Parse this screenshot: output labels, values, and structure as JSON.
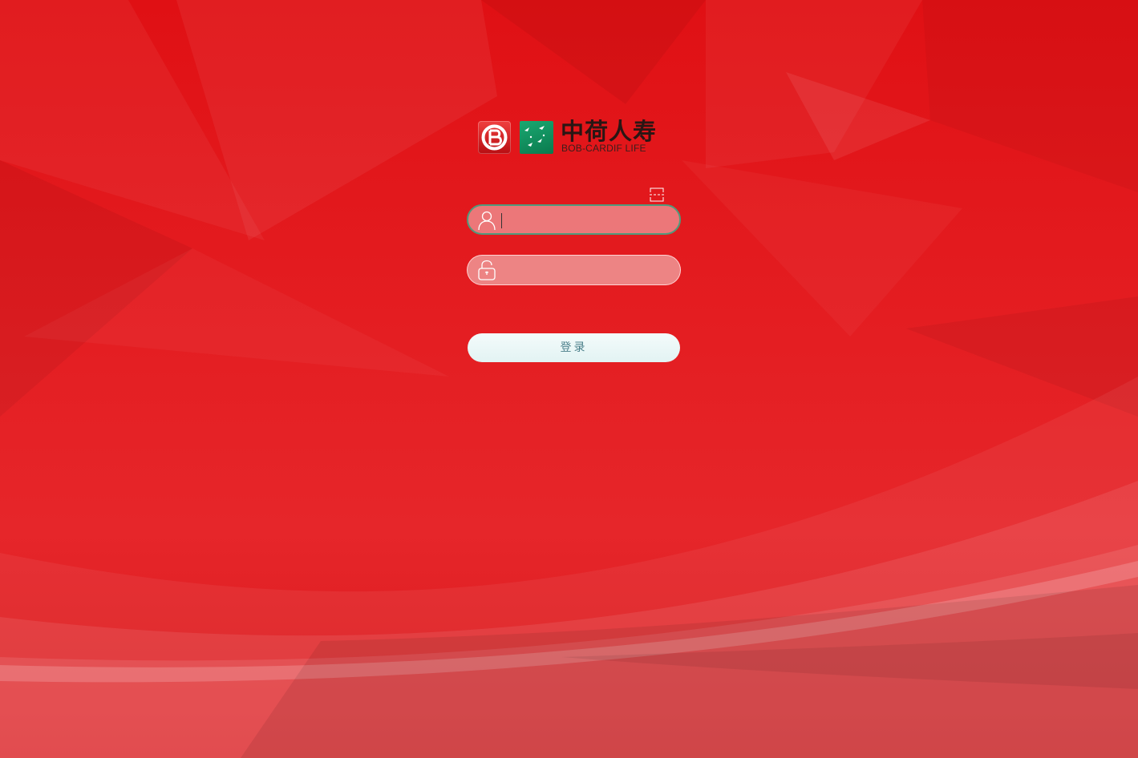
{
  "logo": {
    "name_cn": "中荷人寿",
    "name_en": "BOB-CARDIF LIFE"
  },
  "icons": {
    "qr": "qr-scan-icon",
    "user": "user-icon",
    "lock": "unlock-icon",
    "bank_logo": "bob-logo-icon",
    "cardif_logo": "cardif-birds-icon"
  },
  "form": {
    "username": {
      "value": "",
      "placeholder": ""
    },
    "password": {
      "value": "",
      "placeholder": ""
    },
    "login_label": "登录"
  },
  "colors": {
    "background": "#e31b1f",
    "focus_border": "#4f9a7c",
    "button_text": "#4b7f8a",
    "cardif_green": "#0e8a5a"
  }
}
